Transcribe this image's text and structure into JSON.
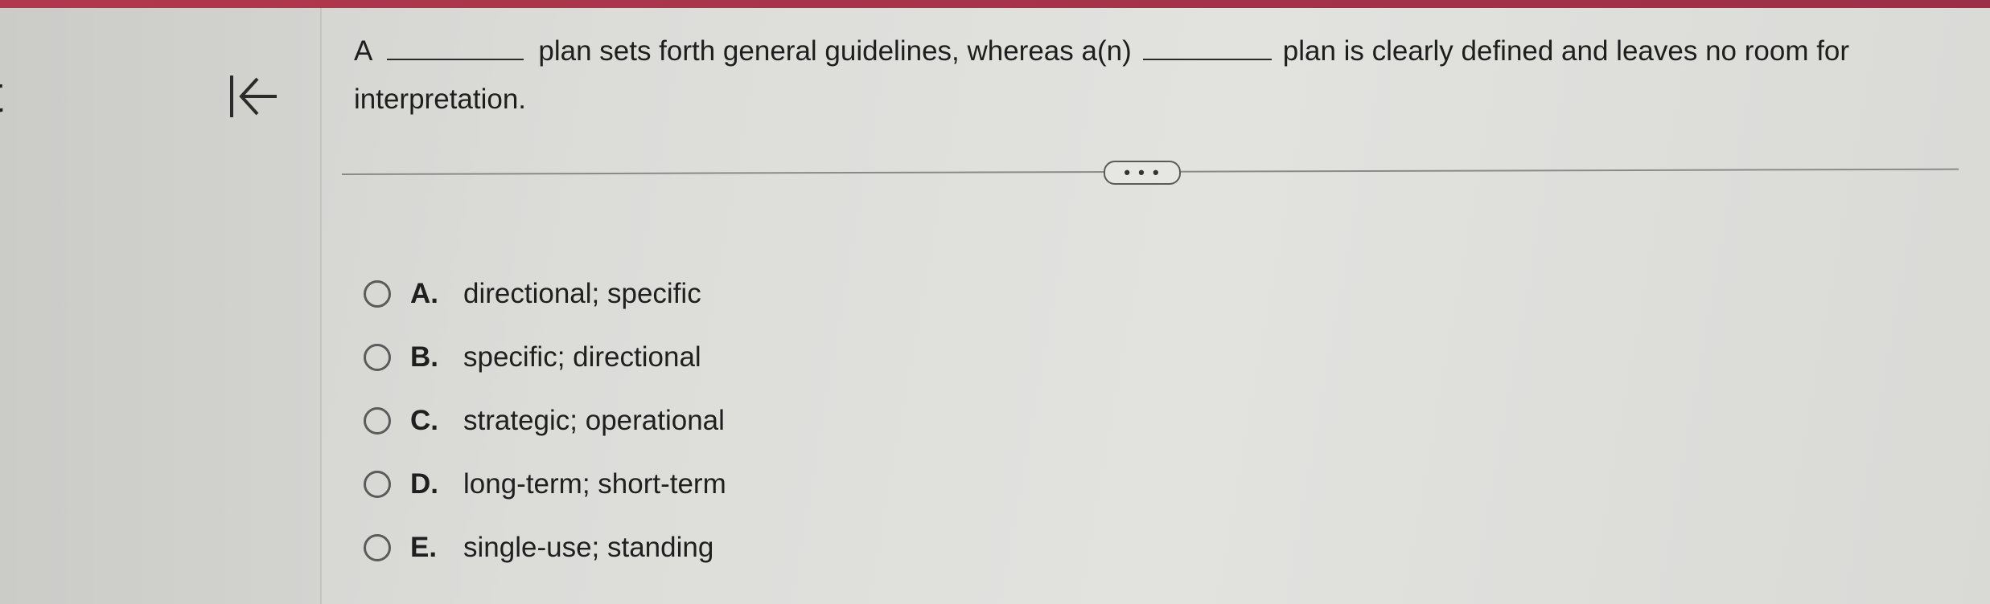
{
  "left_pane": {
    "partial_letter": "t",
    "back_icon": "first-page-arrow-icon"
  },
  "question": {
    "part1": "A",
    "part2": "plan sets forth general guidelines, whereas a(n)",
    "part3": "plan is clearly defined and leaves no room for interpretation."
  },
  "more_button": {
    "label": "• • •"
  },
  "options": [
    {
      "letter": "A.",
      "text": "directional; specific"
    },
    {
      "letter": "B.",
      "text": "specific; directional"
    },
    {
      "letter": "C.",
      "text": "strategic; operational"
    },
    {
      "letter": "D.",
      "text": "long-term; short-term"
    },
    {
      "letter": "E.",
      "text": "single-use; standing"
    }
  ]
}
